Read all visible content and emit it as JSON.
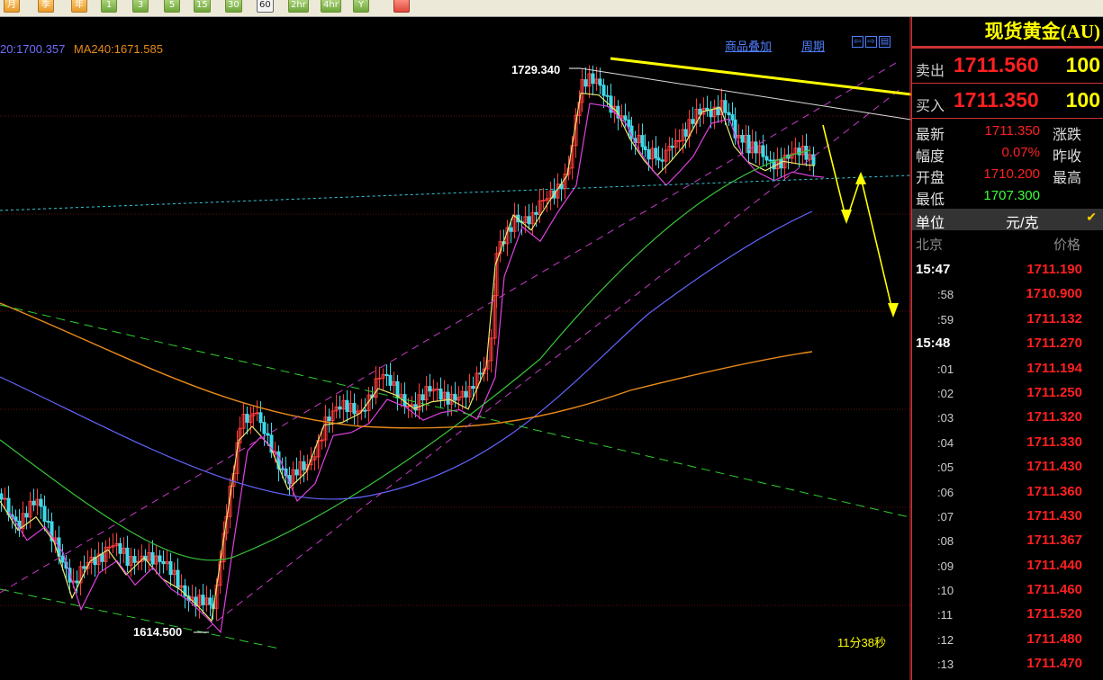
{
  "toolbar": {
    "buttons": [
      "月",
      "季",
      "年",
      "1",
      "3",
      "5",
      "15",
      "30",
      "60",
      "2hr",
      "4hr",
      "Y"
    ],
    "active": "60"
  },
  "chart": {
    "ma_legend": [
      {
        "text": "20:1700.357",
        "color": "#6f6fff"
      },
      {
        "text": "MA240:1671.585",
        "color": "#e88a1a"
      }
    ],
    "link_overlay": "商品叠加",
    "link_period": "周期",
    "high_label": "1729.340",
    "low_label": "1614.500",
    "timer": "11分38秒"
  },
  "panel": {
    "title": "现货黄金(AU)",
    "sell_label": "卖出",
    "sell_price": "1711.560",
    "sell_vol": "100",
    "buy_label": "买入",
    "buy_price": "1711.350",
    "buy_vol": "100",
    "stats": {
      "latest_label": "最新",
      "latest_value": "1711.350",
      "change_label": "涨跌",
      "amp_label": "幅度",
      "amp_value": "0.07%",
      "prevclose_label": "昨收",
      "open_label": "开盘",
      "open_value": "1710.200",
      "high_label": "最高",
      "low_label": "最低",
      "low_value": "1707.300"
    },
    "unit_label": "单位",
    "unit_value": "元/克",
    "col_time": "北京",
    "col_price": "价格",
    "ticks": [
      {
        "t": "15:47",
        "p": "1711.190",
        "major": true
      },
      {
        "t": ":58",
        "p": "1710.900"
      },
      {
        "t": ":59",
        "p": "1711.132"
      },
      {
        "t": "15:48",
        "p": "1711.270",
        "major": true
      },
      {
        "t": ":01",
        "p": "1711.194"
      },
      {
        "t": ":02",
        "p": "1711.250"
      },
      {
        "t": ":03",
        "p": "1711.320"
      },
      {
        "t": ":04",
        "p": "1711.330"
      },
      {
        "t": ":05",
        "p": "1711.430"
      },
      {
        "t": ":06",
        "p": "1711.360"
      },
      {
        "t": ":07",
        "p": "1711.430"
      },
      {
        "t": ":08",
        "p": "1711.367"
      },
      {
        "t": ":09",
        "p": "1711.440"
      },
      {
        "t": ":10",
        "p": "1711.460"
      },
      {
        "t": ":11",
        "p": "1711.520"
      },
      {
        "t": ":12",
        "p": "1711.480"
      },
      {
        "t": ":13",
        "p": "1711.470"
      }
    ]
  }
}
